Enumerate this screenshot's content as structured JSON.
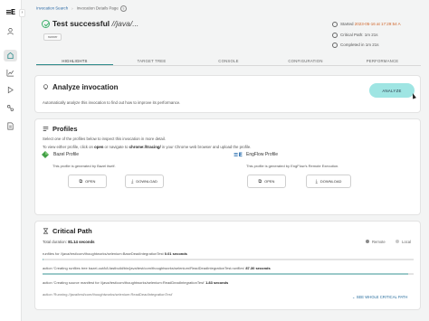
{
  "breadcrumb": {
    "root": "Invocation Search",
    "current": "Invocation Details Page",
    "help": "?"
  },
  "header": {
    "status_title": "Test successful",
    "target": "//java/...",
    "runner_badge": "runner",
    "started_label": "Started",
    "started_value": "2023-05-16 at 17:29:54 A",
    "critical_path": "Critical Path: 1m 21s",
    "completed": "Completed in 1m 21s"
  },
  "tabs": [
    "HIGHLIGHTS",
    "TARGET TREE",
    "CONSOLE",
    "CONFIGURATION",
    "PERFORMANCE"
  ],
  "analyze": {
    "title": "Analyze invocation",
    "description": "Automatically analyze this invocation to find out how to improve its performance.",
    "button": "ANALYZE"
  },
  "profiles": {
    "title": "Profiles",
    "line1": "Select one of the profiles below to inspect this invocation in more detail.",
    "line2_pre": "To view either profile, click on ",
    "line2_open": "open",
    "line2_mid": " or navigate to ",
    "line2_url": "chrome://tracing/",
    "line2_post": " in your Chrome web browser and upload the profile.",
    "items": [
      {
        "name": "Bazel Profile",
        "desc": "This profile is generated by Bazel itself.",
        "open": "OPEN",
        "download": "DOWNLOAD"
      },
      {
        "name": "EngFlow Profile",
        "desc": "This profile is generated by EngFlow's Remote Execution.",
        "open": "OPEN",
        "download": "DOWNLOAD"
      }
    ]
  },
  "critical_path": {
    "title": "Critical Path",
    "total_label": "Total duration: ",
    "total_value": "81.14 seconds",
    "legend_remote": "Remote",
    "legend_local": "Local",
    "rows": [
      {
        "text": "runfiles for //java/test/com/thoughtworks/selenium:BaseDeadIntegrationTest",
        "dur": "0.01 seconds"
      },
      {
        "text": "action 'Creating runfiles tree bazel-out/k8-fastbuild/bin/java/test/com/thoughtworks/selenium/ReadDeadIntegrationTest.runfiles'",
        "dur": "87.30 seconds"
      },
      {
        "text": "action 'Creating source manifest for //java/test/com/thoughtworks/selenium:ReadDeadIntegrationTest'",
        "dur": "1.83 seconds"
      },
      {
        "text": "action 'Running //java/test/com/thoughtworks/selenium:ReadDeadIntegrationTest'",
        "dur": ""
      }
    ],
    "see_all": "SEE WHOLE CRITICAL PATH"
  },
  "colors": {
    "accent": "#2c8a8a",
    "success": "#3bb06a",
    "analyze_button": "#9fe5e3",
    "legend_remote": "#8a8a8a",
    "legend_local": "#c9c9c9"
  }
}
